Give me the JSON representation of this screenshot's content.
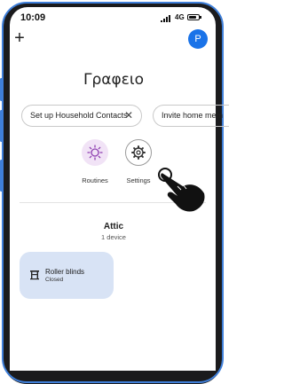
{
  "status_bar": {
    "time": "10:09",
    "network": "4G"
  },
  "header": {
    "avatar_initial": "P",
    "add_icon": "plus-icon",
    "add_glyph": "+"
  },
  "home": {
    "title": "Γραφειο"
  },
  "chips": [
    {
      "label": "Set up Household Contacts",
      "close_glyph": "✕"
    },
    {
      "label": "Invite home mem"
    }
  ],
  "shortcuts": [
    {
      "label": "Routines",
      "icon": "routines-icon"
    },
    {
      "label": "Settings",
      "icon": "gear-icon"
    }
  ],
  "room": {
    "name": "Attic",
    "device_count": "1 device"
  },
  "devices": [
    {
      "name": "Roller blinds",
      "status": "Closed",
      "icon": "blinds-icon"
    }
  ],
  "colors": {
    "accent": "#1a73e8",
    "device_card": "#d8e3f5",
    "routines_tile": "#f1e3f6",
    "phone_frame_highlight": "#3f7fd9"
  },
  "overlay": {
    "pointer": "tap-hand-icon"
  }
}
